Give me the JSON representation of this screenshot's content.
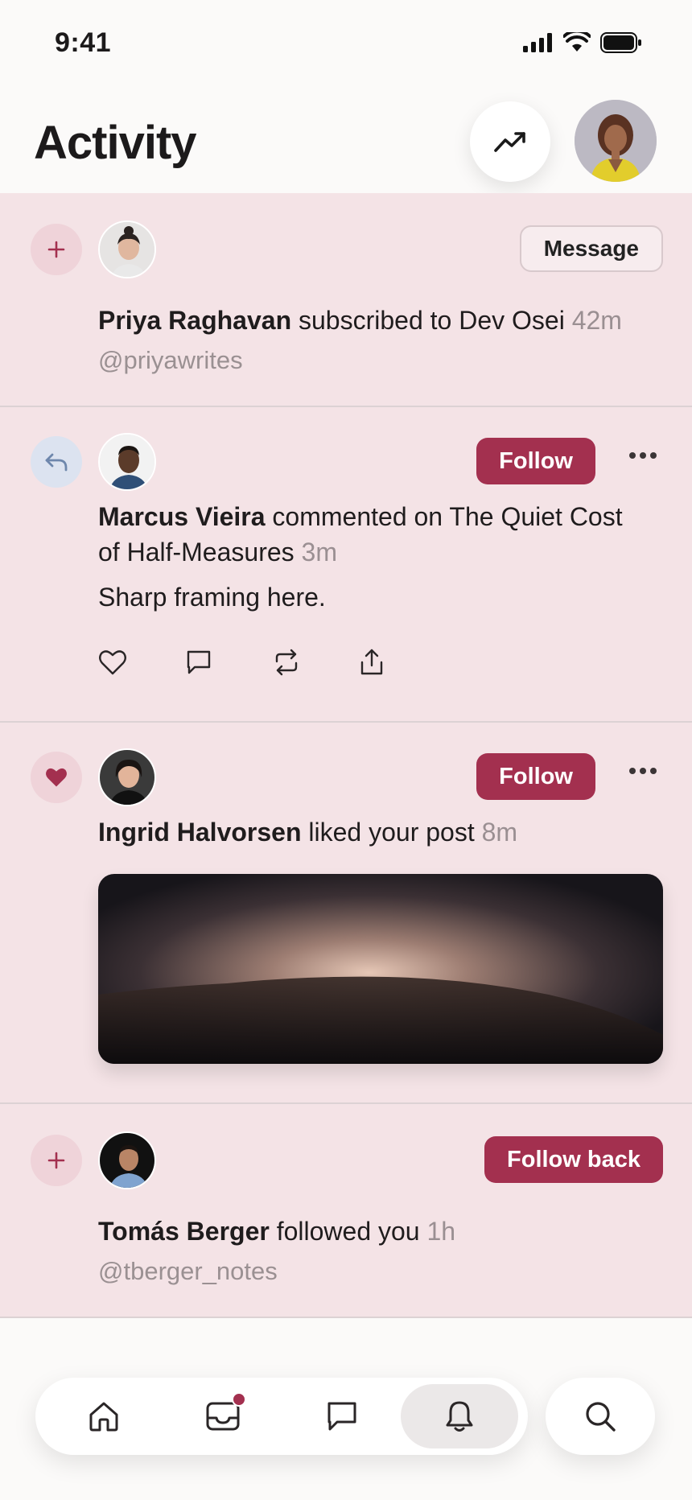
{
  "status_bar": {
    "time": "9:41"
  },
  "header": {
    "title": "Activity"
  },
  "feed": [
    {
      "type": "subscribe",
      "name": "Priya Raghavan",
      "action": "subscribed to Dev Osei",
      "time": "42m",
      "handle": "@priyawrites",
      "button": "Message"
    },
    {
      "type": "comment",
      "name": "Marcus Vieira",
      "action": "commented on The Quiet Cost of Half-Measures",
      "time": "3m",
      "comment": "Sharp framing here.",
      "button": "Follow"
    },
    {
      "type": "like",
      "name": "Ingrid Halvorsen",
      "action": "liked your post",
      "time": "8m",
      "button": "Follow"
    },
    {
      "type": "follow",
      "name": "Tomás Berger",
      "action": "followed you",
      "time": "1h",
      "handle": "@tberger_notes",
      "button": "Follow back"
    }
  ],
  "colors": {
    "accent": "#a3304f",
    "feed_background": "#f4e3e6",
    "badge_pink": "#efd3d9",
    "badge_blue": "#dce3f0"
  },
  "tabbar": {
    "items": [
      "home-icon",
      "inbox-icon",
      "messages-icon",
      "bell-icon"
    ],
    "active": "bell-icon",
    "search": "search-icon"
  }
}
